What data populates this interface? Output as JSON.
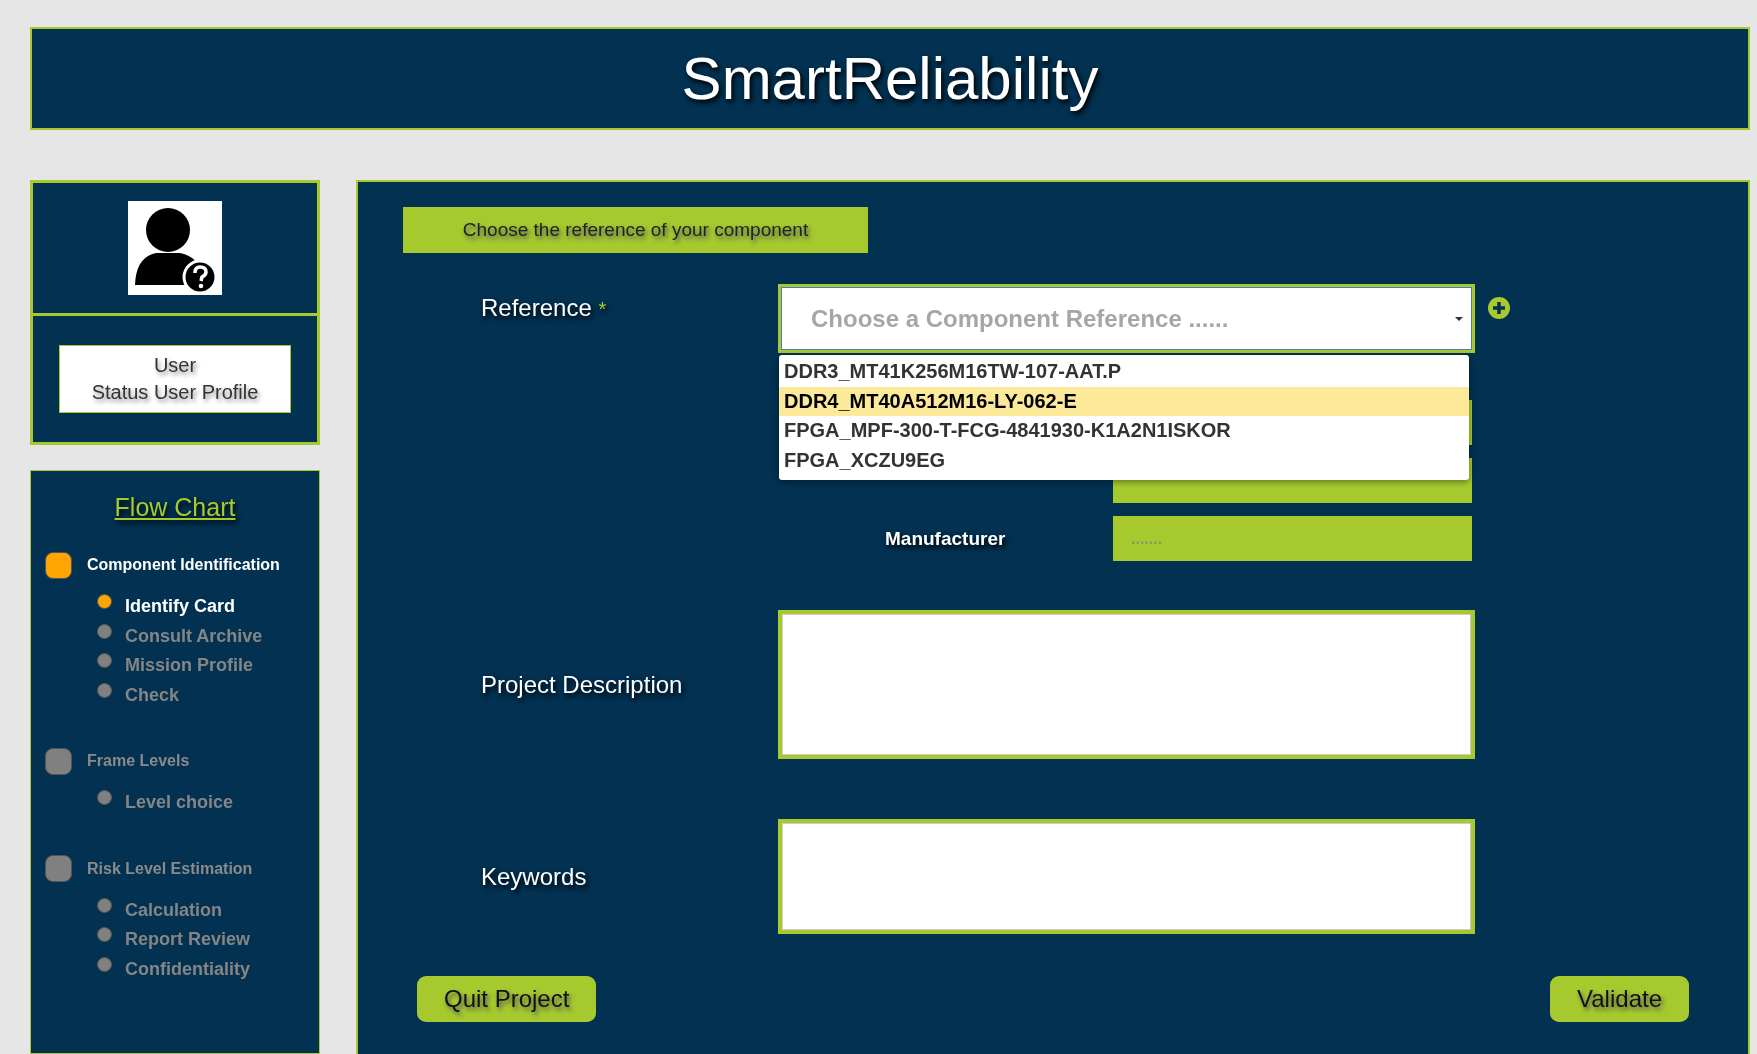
{
  "header": {
    "title": "SmartReliability"
  },
  "profile": {
    "name": "User",
    "status": "Status User Profile"
  },
  "flow_chart": {
    "title": "Flow Chart",
    "steps": [
      {
        "label": "Component Identification",
        "active": true,
        "children": [
          {
            "label": "Identify Card",
            "active": true
          },
          {
            "label": "Consult Archive",
            "active": false
          },
          {
            "label": "Mission Profile",
            "active": false
          },
          {
            "label": "Check",
            "active": false
          }
        ]
      },
      {
        "label": "Frame Levels",
        "active": false,
        "children": [
          {
            "label": "Level choice",
            "active": false
          }
        ]
      },
      {
        "label": "Risk Level Estimation",
        "active": false,
        "children": [
          {
            "label": "Calculation",
            "active": false
          },
          {
            "label": "Report Review",
            "active": false
          },
          {
            "label": "Confidentiality",
            "active": false
          }
        ]
      }
    ]
  },
  "form": {
    "section_label": "Choose the reference of your component",
    "reference": {
      "label": "Reference",
      "required_mark": "*",
      "placeholder": "Choose a Component Reference ......",
      "expanded": true,
      "options": [
        {
          "label": "DDR3_MT41K256M16TW-107-AAT.P",
          "selected": false
        },
        {
          "label": "DDR4_MT40A512M16-LY-062-E",
          "selected": true
        },
        {
          "label": "FPGA_MPF-300-T-FCG-4841930-K1A2N1ISKOR",
          "selected": false
        },
        {
          "label": "FPGA_XCZU9EG",
          "selected": false
        }
      ]
    },
    "manufacturer": {
      "label": "Manufacturer",
      "placeholder": "......."
    },
    "project_description": {
      "label": "Project Description"
    },
    "keywords": {
      "label": "Keywords"
    },
    "buttons": [
      {
        "label": "Quit Project"
      },
      {
        "label": "Validate"
      }
    ]
  }
}
